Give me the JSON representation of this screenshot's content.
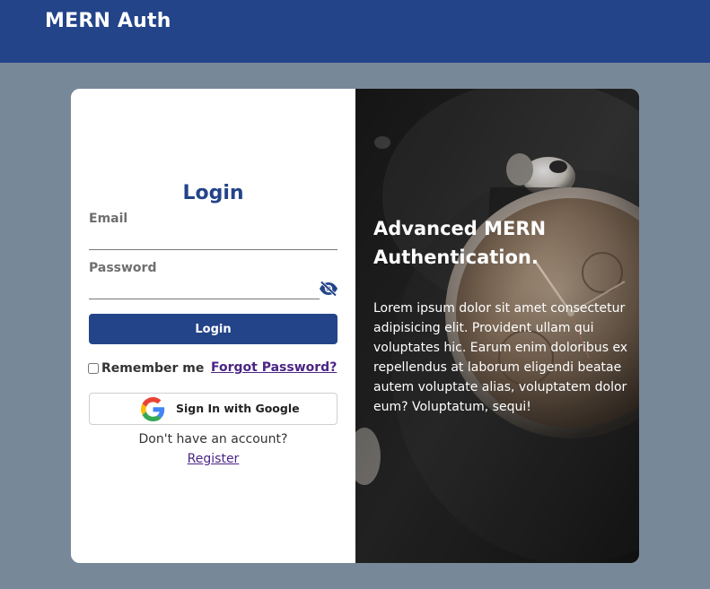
{
  "navbar": {
    "brand": "MERN Auth"
  },
  "login": {
    "title": "Login",
    "email_label": "Email",
    "email_value": "",
    "password_label": "Password",
    "password_value": "",
    "login_button": "Login",
    "remember_label": "Remember me",
    "remember_checked": false,
    "forgot_link": "Forgot Password?",
    "google_button": "Sign In with Google",
    "no_account_text": "Don't have an account?",
    "register_link": "Register"
  },
  "hero": {
    "heading": "Advanced MERN Authentication.",
    "body": "Lorem ipsum dolor sit amet consectetur adipisicing elit. Provident ullam qui voluptates hic. Earum enim doloribus ex repellendus at laborum eligendi beatae autem voluptate alias, voluptatem dolor eum? Voluptatum, sequi!",
    "image": "watch-and-earbuds-photo"
  },
  "colors": {
    "navbar": "#234489",
    "page_background": "#778899",
    "accent": "#234489",
    "link": "#4b2585"
  },
  "icons": {
    "password_toggle": "eye-slash-icon",
    "google": "google-icon"
  }
}
